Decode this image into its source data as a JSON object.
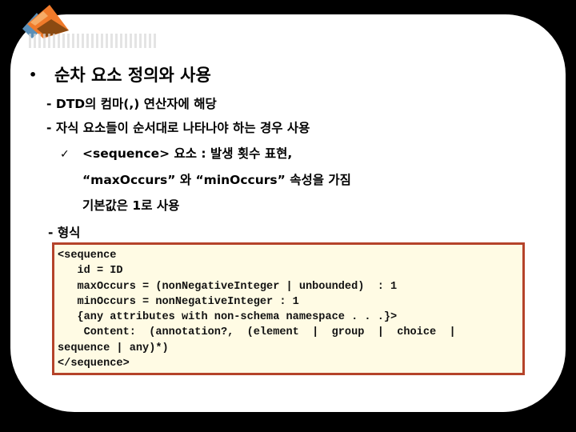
{
  "slide": {
    "heading": "순차 요소 정의와 사용",
    "bullet_glyph": "•",
    "items": [
      "- DTD의 컴마(,) 연산자에 해당",
      "- 자식 요소들이 순서대로 나타나야 하는 경우 사용",
      "<sequence> 요소 : 발생 횟수 표현,",
      "“maxOccurs” 와 “minOccurs” 속성을 가짐",
      "기본값은 1로 사용",
      "- 형식"
    ],
    "check_glyph": "✓",
    "code_lines": [
      "<sequence",
      "   id = ID",
      "   maxOccurs = (nonNegativeInteger | unbounded)  : 1",
      "   minOccurs = nonNegativeInteger : 1",
      "   {any attributes with non-schema namespace . . .}>",
      "    Content:  (annotation?,  (element  |  group  |  choice  |",
      "sequence | any)*)",
      "</sequence>"
    ]
  },
  "colors": {
    "code_border": "#b5432a",
    "code_background": "#fffbe4",
    "panel": "#ffffff",
    "backdrop": "#000000"
  }
}
